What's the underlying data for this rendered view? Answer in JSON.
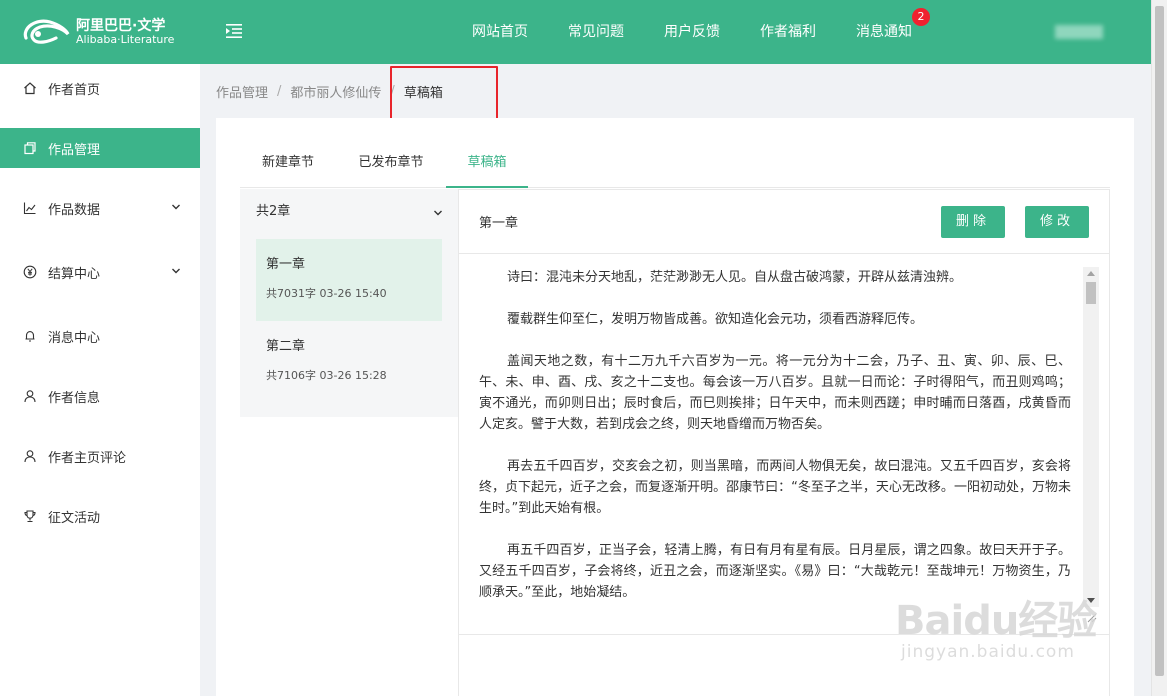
{
  "header": {
    "logo_text": "阿里巴巴·文学",
    "logo_sub": "Alibaba·Literature",
    "nav": [
      {
        "label": "网站首页"
      },
      {
        "label": "常见问题"
      },
      {
        "label": "用户反馈"
      },
      {
        "label": "作者福利"
      },
      {
        "label": "消息通知",
        "badge": "2"
      }
    ],
    "colors": {
      "brand": "#3cb48a",
      "badge": "#f0212f"
    }
  },
  "sidebar": {
    "items": [
      {
        "label": "作者首页",
        "icon": "home-icon"
      },
      {
        "label": "作品管理",
        "icon": "copy-icon",
        "active": true
      },
      {
        "label": "作品数据",
        "icon": "chart-line-icon",
        "expandable": true
      },
      {
        "label": "结算中心",
        "icon": "yen-circle-icon",
        "expandable": true
      },
      {
        "label": "消息中心",
        "icon": "bell-icon"
      },
      {
        "label": "作者信息",
        "icon": "user-icon"
      },
      {
        "label": "作者主页评论",
        "icon": "user-icon"
      },
      {
        "label": "征文活动",
        "icon": "trophy-icon"
      }
    ]
  },
  "breadcrumb": {
    "items": [
      "作品管理",
      "都市丽人修仙传",
      "草稿箱"
    ],
    "separator": "/"
  },
  "tabs": [
    {
      "label": "新建章节"
    },
    {
      "label": "已发布章节"
    },
    {
      "label": "草稿箱",
      "active": true
    }
  ],
  "chapter_list": {
    "summary": "共2章",
    "items": [
      {
        "title": "第一章",
        "meta": "共7031字 03-26 15:40",
        "active": true
      },
      {
        "title": "第二章",
        "meta": "共7106字 03-26 15:28"
      }
    ]
  },
  "editor": {
    "title": "第一章",
    "delete_label": "删除",
    "edit_label": "修改",
    "paragraphs": [
      "诗曰：混沌未分天地乱，茫茫渺渺无人见。自从盘古破鸿蒙，开辟从兹清浊辨。",
      "覆载群生仰至仁，发明万物皆成善。欲知造化会元功，须看西游释厄传。",
      "盖闻天地之数，有十二万九千六百岁为一元。将一元分为十二会，乃子、丑、寅、卯、辰、巳、午、未、申、酉、戌、亥之十二支也。每会该一万八百岁。且就一日而论：子时得阳气，而丑则鸡鸣；寅不通光，而卯则日出；辰时食后，而巳则挨排；日午天中，而未则西蹉；申时晡而日落酉，戌黄昏而人定亥。譬于大数，若到戌会之终，则天地昏缯而万物否矣。",
      "再去五千四百岁，交亥会之初，则当黑暗，而两间人物俱无矣，故曰混沌。又五千四百岁，亥会将终，贞下起元，近子之会，而复逐渐开明。邵康节曰：“冬至子之半，天心无改移。一阳初动处，万物未生时。”到此天始有根。",
      "再五千四百岁，正当子会，轻清上腾，有日有月有星有辰。日月星辰，谓之四象。故曰天开于子。又经五千四百岁，子会将终，近丑之会，而逐渐坚实。《易》曰：“大哉乾元！至哉坤元！万物资生，乃顺承天。”至此，地始凝结。"
    ]
  },
  "watermark": {
    "main": "Baidu经验",
    "sub": "jingyan.baidu.com"
  }
}
